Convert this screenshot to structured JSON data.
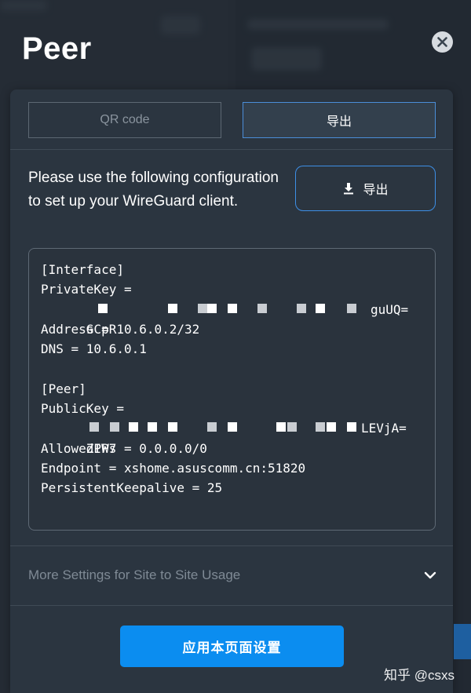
{
  "dialog": {
    "title": "Peer"
  },
  "tabs": [
    {
      "label": "QR code",
      "active": false
    },
    {
      "label": "导出",
      "active": true
    }
  ],
  "instruction": "Please use the following configuration to set up your WireGuard client.",
  "export_button": {
    "label": "导出",
    "icon": "download-icon"
  },
  "config": {
    "lines": [
      "[Interface]",
      "PrivateKey =",
      "GCpR",
      "Address = 10.6.0.2/32",
      "DNS = 10.6.0.1",
      "",
      "[Peer]",
      "PublicKey =",
      "ZPW7",
      "AllowedIPs = 0.0.0.0/0",
      "Endpoint = xshome.asuscomm.cn:51820",
      "PersistentKeepalive = 25"
    ],
    "private_key_tail": "guUQ=",
    "public_key_tail": "LEVjA="
  },
  "more_settings": {
    "label": "More Settings for Site to Site Usage",
    "icon": "chevron-down-icon"
  },
  "apply_button": {
    "label": "应用本页面设置"
  },
  "watermark": "知乎 @csxs",
  "colors": {
    "accent": "#0b8df0",
    "tab_active_border": "#4a8ed8",
    "panel_bg": "#2b3540"
  }
}
